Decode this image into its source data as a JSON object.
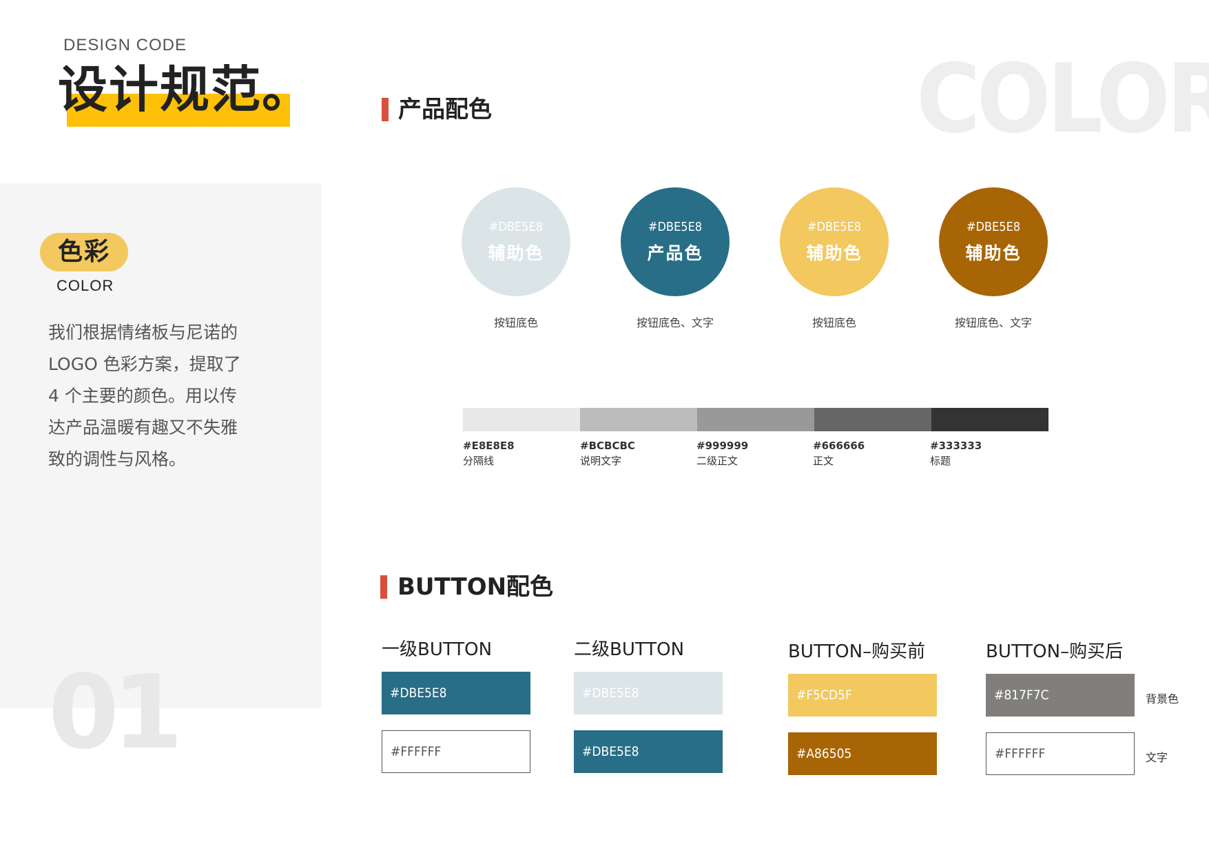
{
  "header": {
    "eyebrow": "DESIGN  CODE",
    "title": "设计规范。",
    "watermark": "COLOR"
  },
  "left_panel": {
    "badge": "色彩",
    "badge_sub": "COLOR",
    "description_lines": [
      "我们根据情绪板与尼诺的",
      "LOGO 色彩方案，提取了",
      "4 个主要的颜色。用以传",
      "达产品温暖有趣又不失雅",
      "致的调性与风格。"
    ],
    "watermark_number": "01"
  },
  "product_colors": {
    "heading": "产品配色",
    "circles": [
      {
        "hex_label": "#DBE5E8",
        "name": "辅助色",
        "usage": "按钮底色",
        "color": "#dbe5e8"
      },
      {
        "hex_label": "#DBE5E8",
        "name": "产品色",
        "usage": "按钮底色、文字",
        "color": "#276e86"
      },
      {
        "hex_label": "#DBE5E8",
        "name": "辅助色",
        "usage": "按钮底色",
        "color": "#f2c85f"
      },
      {
        "hex_label": "#DBE5E8",
        "name": "辅助色",
        "usage": "按钮底色、文字",
        "color": "#a86505"
      }
    ],
    "grays": [
      {
        "hex": "#E8E8E8",
        "label": "分隔线",
        "color": "#e8e8e8"
      },
      {
        "hex": "#BCBCBC",
        "label": "说明文字",
        "color": "#bcbcbc"
      },
      {
        "hex": "#999999",
        "label": "二级正文",
        "color": "#999999"
      },
      {
        "hex": "#666666",
        "label": "正文",
        "color": "#666666"
      },
      {
        "hex": "#333333",
        "label": "标题",
        "color": "#333333"
      }
    ]
  },
  "button_colors": {
    "heading": "BUTTON配色",
    "columns": [
      {
        "title": "一级BUTTON",
        "top": {
          "text": "#DBE5E8",
          "bg": "#276e86",
          "fg": "#ffffff"
        },
        "bottom": {
          "text": "#FFFFFF",
          "bg": "#ffffff",
          "fg": "#555555",
          "border": "#555555"
        }
      },
      {
        "title": "二级BUTTON",
        "top": {
          "text": "#DBE5E8",
          "bg": "#dbe5e8",
          "fg": "#ffffff"
        },
        "bottom": {
          "text": "#DBE5E8",
          "bg": "#276e86",
          "fg": "#ffffff"
        }
      },
      {
        "title": "BUTTON–购买前",
        "top": {
          "text": "#F5CD5F",
          "bg": "#f2c85f",
          "fg": "#ffffff"
        },
        "bottom": {
          "text": "#A86505",
          "bg": "#a86505",
          "fg": "#ffffff"
        }
      },
      {
        "title": "BUTTON–购买后",
        "top": {
          "text": "#817F7C",
          "bg": "#817f7c",
          "fg": "#ffffff"
        },
        "bottom": {
          "text": "#FFFFFF",
          "bg": "#ffffff",
          "fg": "#555555",
          "border": "#555555"
        }
      }
    ],
    "side_labels": {
      "bg": "背景色",
      "text": "文字"
    }
  },
  "accent_colors": {
    "highlight": "#ffc107",
    "section_marker": "#d94f3a"
  }
}
